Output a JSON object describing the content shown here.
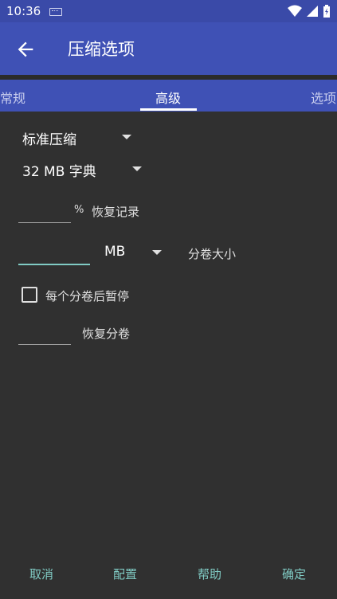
{
  "status_bar": {
    "time": "10:36"
  },
  "toolbar": {
    "title": "压缩选项"
  },
  "tabs": [
    {
      "label": "常规"
    },
    {
      "label": "高级"
    },
    {
      "label": "选项"
    }
  ],
  "advanced": {
    "compression_method": "标准压缩",
    "dictionary_size": "32 MB 字典",
    "recovery_record": {
      "value": "",
      "unit": "%",
      "label": "恢复记录"
    },
    "volume_size": {
      "value": "",
      "unit": "MB",
      "label": "分卷大小"
    },
    "pause_after_volume": {
      "label": "每个分卷后暂停",
      "checked": false
    },
    "recovery_volumes": {
      "value": "",
      "label": "恢复分卷"
    }
  },
  "buttons": {
    "cancel": "取消",
    "profiles": "配置",
    "help": "帮助",
    "ok": "确定"
  },
  "colors": {
    "primary": "#3f51b5",
    "accent": "#80cbc4",
    "background": "#303030"
  }
}
